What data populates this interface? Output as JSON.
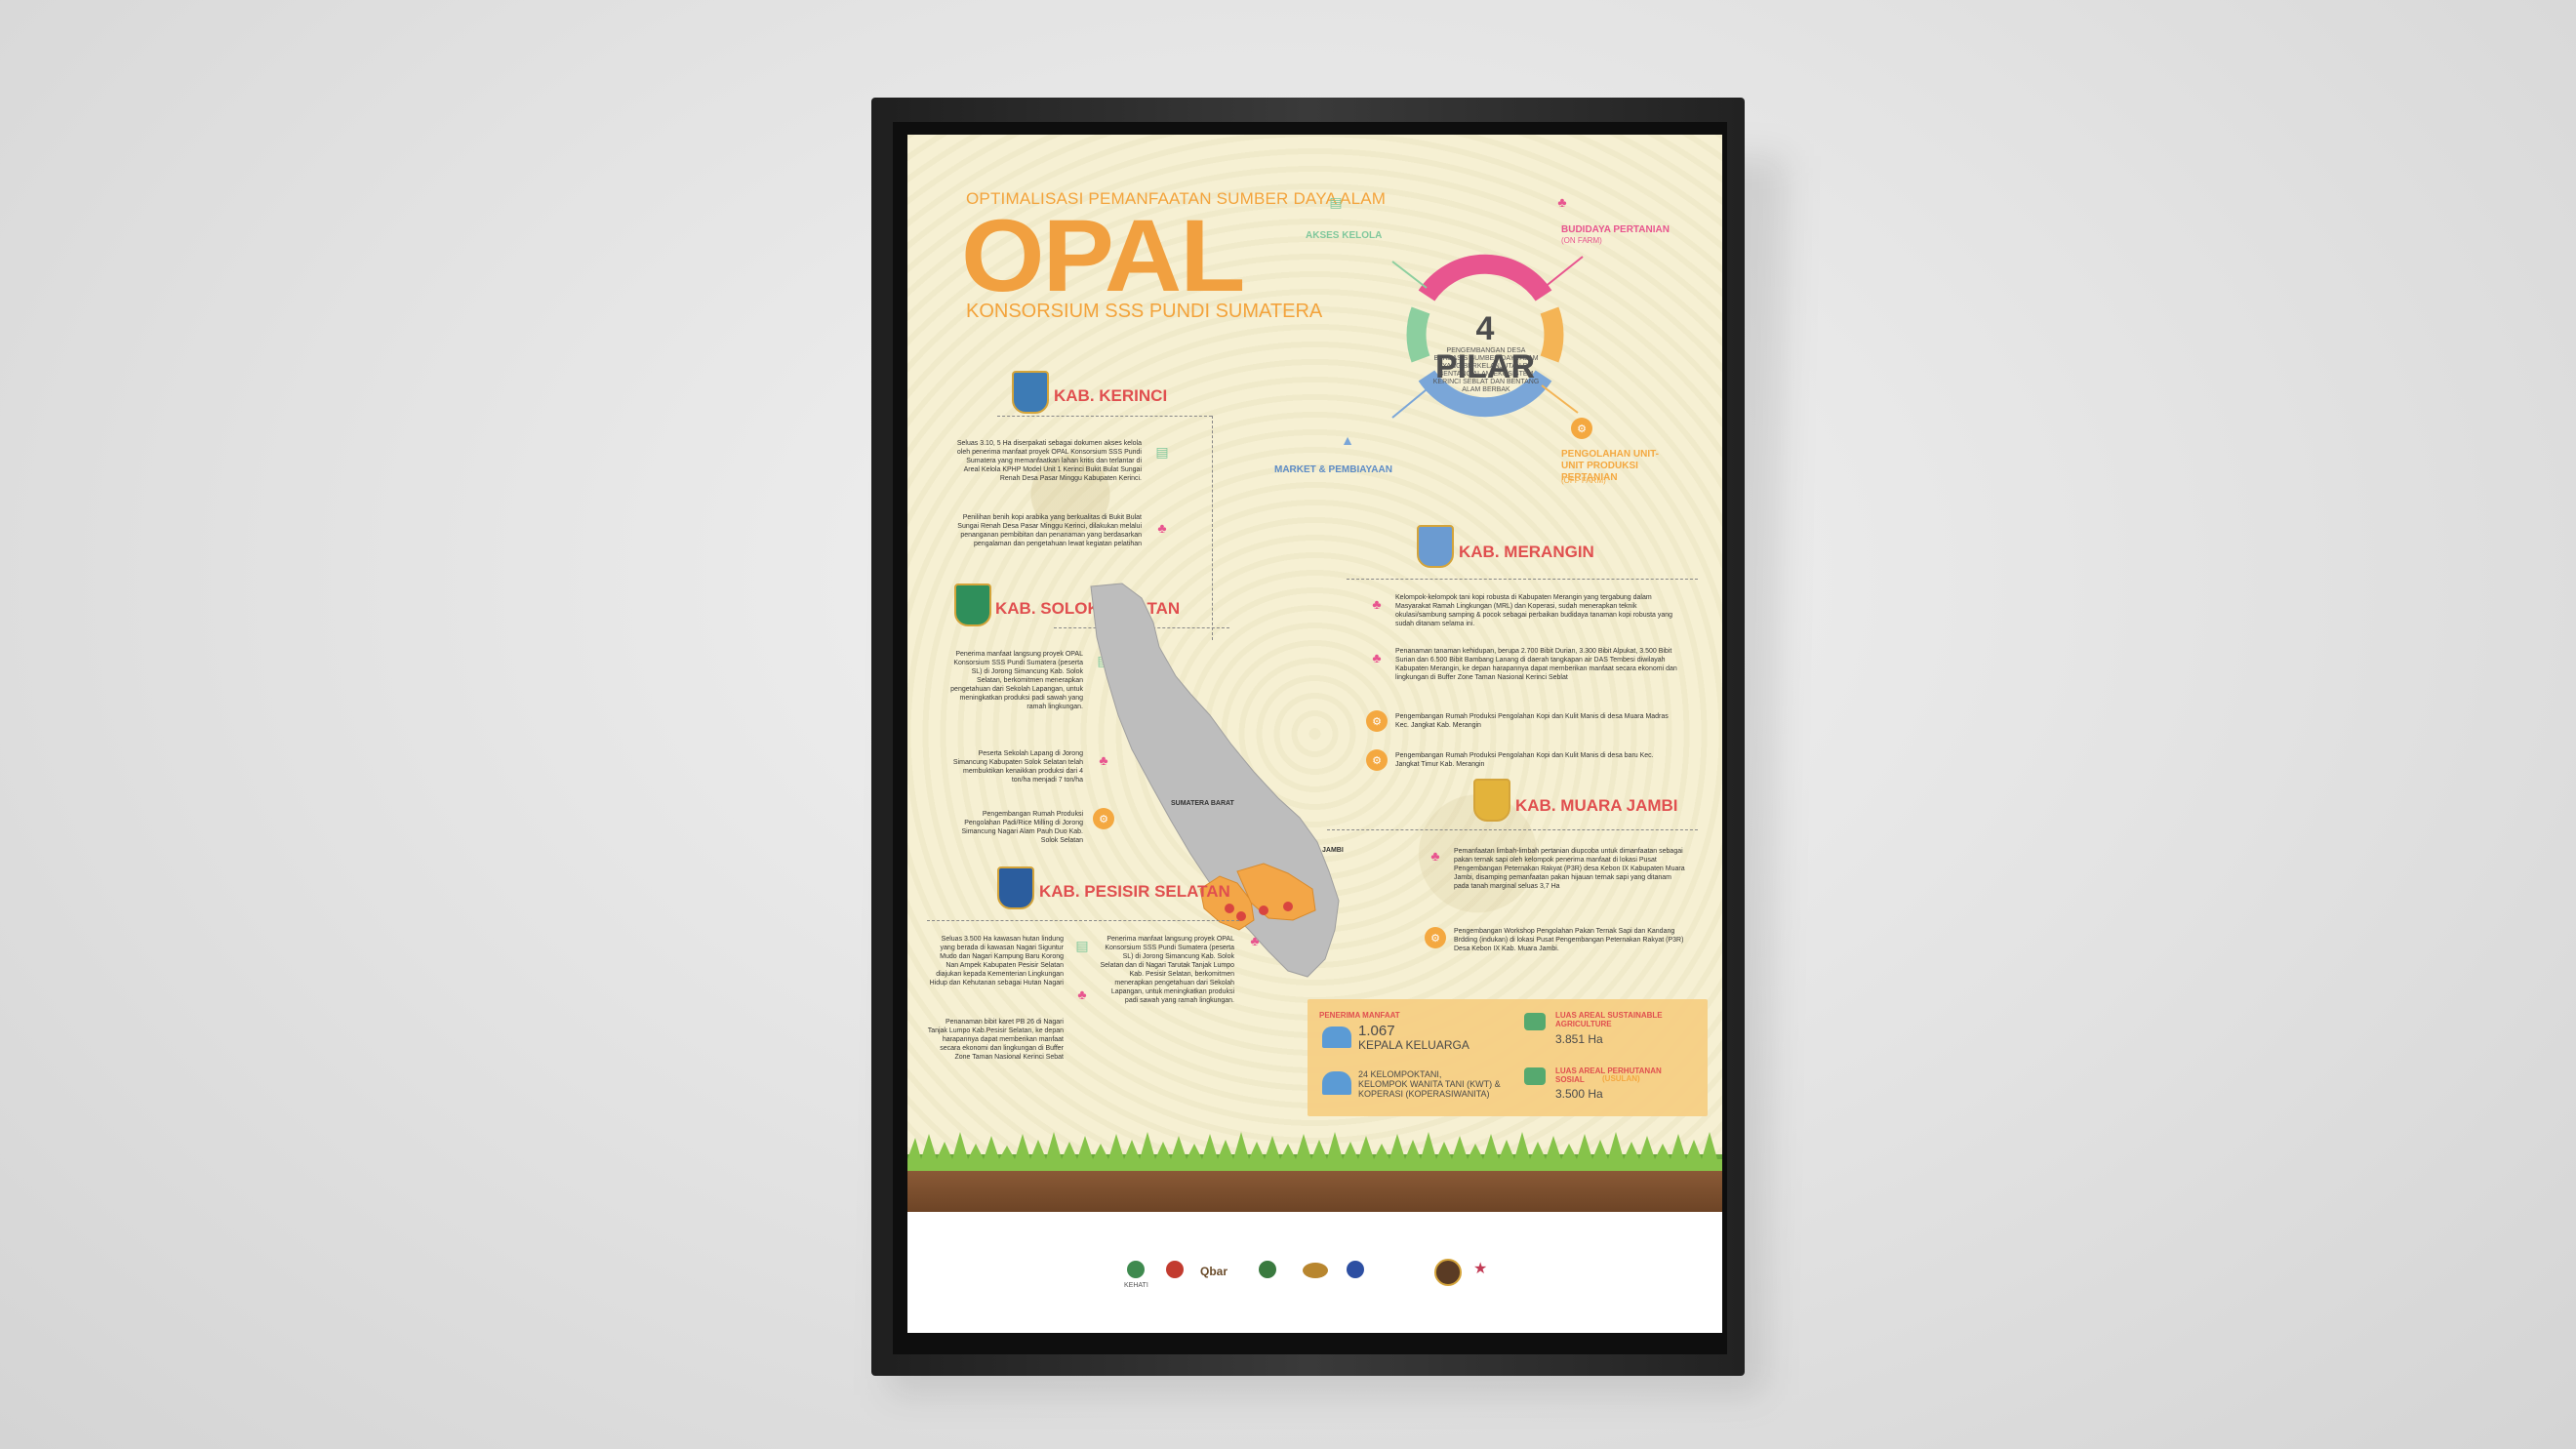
{
  "header": {
    "subtitle": "OPTIMALISASI PEMANFAATAN SUMBER DAYA ALAM",
    "title": "OPAL",
    "consortium": "KONSORSIUM SSS PUNDI SUMATERA"
  },
  "pilar": {
    "title": "4 PILAR",
    "description": "PENGEMBANGAN DESA BERBASIS SUMBER DAYA ALAM YANG BERKELANJUTAN DI BENTANG ALAM EKOSISTEM KERINCI SEBLAT DAN BENTANG ALAM BERBAK",
    "akses": "AKSES KELOLA",
    "budidaya": "BUDIDAYA PERTANIAN",
    "budidaya_sub": "(ON FARM)",
    "market": "MARKET & PEMBIAYAAN",
    "pengolahan": "PENGOLAHAN UNIT-UNIT PRODUKSI PERTANIAN",
    "pengolahan_sub": "(OFF FARM)",
    "colors": {
      "pink": "#e8558f",
      "orange": "#f4b455",
      "blue": "#7aa6d8",
      "green": "#8ccf9f"
    }
  },
  "kerinci": {
    "name": "KAB. KERINCI",
    "p1": "Seluas 3.10, 5 Ha diserpakati sebagai dokumen akses kelola oleh penerima manfaat proyek OPAL Konsorsium SSS Pundi Sumatera yang memanfaatkan lahan kritis dan terlantar di Areal Kelola KPHP Model Unit 1 Kerinci Bukit Bulat Sungai Renah Desa Pasar Minggu Kabupaten Kerinci.",
    "p2": "Penilihan benih kopi arabika yang berkualitas di Bukit Bulat Sungai Renah Desa Pasar Minggu Kerinci, dilakukan melalui penanganan pembibitan dan penanaman yang berdasarkan pengalaman dan pengetahuan lewat kegiatan pelatihan"
  },
  "solok": {
    "name": "KAB. SOLOK SELATAN",
    "p1": "Penerima manfaat langsung proyek OPAL Konsorsium SSS Pundi Sumatera (peserta SL) di Jorong Simancung Kab. Solok Selatan, berkomitmen menerapkan pengetahuan dari Sekolah Lapangan, untuk meningkatkan produksi padi sawah yang ramah lingkungan.",
    "p2": "Peserta Sekolah Lapang di Jorong Simancung Kabupaten Solok Selatan telah membuktikan kenaikkan produksi dari 4 ton/ha menjadi 7 ton/ha",
    "p3": "Pengembangan Rumah Produksi Pengolahan Padi/Rice Milling di Jorong Simancung Nagari Alam Pauh Duo Kab. Solok Selatan"
  },
  "pesisir": {
    "name": "KAB. PESISIR SELATAN",
    "p1": "Seluas 3.500 Ha kawasan hutan lindung yang berada di kawasan Nagari Siguntur Mudo dan Nagari Kampung Baru Korong Nan Ampek Kabupaten Pesisir Selatan diajukan kepada Kementerian Lingkungan Hidup dan Kehutanan sebagai Hutan Nagari",
    "p2": "Penanaman bibit karet PB 26 di Nagari Tanjak Lumpo Kab.Pesisir Selatan, ke depan harapannya dapat memberikan manfaat secara ekonomi dan lingkungan di Buffer Zone Taman Nasional Kerinci Sebat",
    "p3": "Penerima manfaat langsung proyek OPAL Konsorsium SSS Pundi Sumatera (peserta SL) di Jorong Simancung Kab. Solok Selatan dan di Nagari Tarutak Tanjak Lumpo Kab. Pesisir Selatan, berkomitmen menerapkan pengetahuan dari Sekolah Lapangan, untuk meningkatkan produksi padi sawah yang ramah lingkungan."
  },
  "merangin": {
    "name": "KAB. MERANGIN",
    "p1": "Kelompok-kelompok tani kopi robusta di Kabupaten Merangin yang tergabung dalam Masyarakat Ramah Lingkungan (MRL) dan Koperasi, sudah menerapkan teknik okulasi/sambung samping & pocok sebagai perbaikan budidaya tanaman kopi robusta yang sudah ditanam selama ini.",
    "p2": "Penanaman tanaman kehidupan, berupa 2.700 Bibit Durian, 3.300 Bibit Alpukat, 3.500 Bibit Surian dan 6.500 Bibit Bambang Lanang di daerah tangkapan air DAS Tembesi diwilayah Kabupaten Merangin, ke depan harapannya dapat memberikan manfaat secara ekonomi dan lingkungan di Buffer Zone Taman Nasional Kerinci Seblat",
    "p3": "Pengembangan Rumah Produksi Pengolahan Kopi dan Kulit Manis di desa Muara Madras Kec. Jangkat Kab. Merangin",
    "p4": "Pengembangan Rumah Produksi Pengolahan Kopi dan Kulit Manis di desa baru Kec. Jangkat Timur Kab. Merangin"
  },
  "muara_jambi": {
    "name": "KAB. MUARA JAMBI",
    "p1": "Pemanfaatan limbah-limbah pertanian diupcoba untuk dimanfaatan sebagai pakan ternak sapi oleh kelompok penerima manfaat di lokasi Pusat Pengembangan Peternakan Rakyat (P3R) desa Kebon IX Kabupaten Muara Jambi, disamping pemanfaatan pakan hijauan ternak sapi yang ditanam pada tanah marginal seluas 3,7 Ha",
    "p2": "Pengembangan Workshop Pengolahan Pakan Ternak Sapi dan Kandang Brdding (indukan) di lokasi Pusat Pengembangan Peternakan Rakyat (P3R) Desa Kebon IX Kab. Muara Jambi."
  },
  "map": {
    "label_sumbar": "SUMATERA BARAT",
    "label_jambi": "JAMBI"
  },
  "stats": {
    "penerima_title": "PENERIMA MANFAAT",
    "kk_value": "1.067",
    "kk_label": "KEPALA KELUARGA",
    "kwt_value": "24 KELOMPOKTANI,",
    "kwt_label": "KELOMPOK WANITA TANI (KWT) & KOPERASI (KOPERASIWANITA)",
    "areal1_title": "LUAS AREAL SUSTAINABLE AGRICULTURE",
    "areal1_value": "3.851 Ha",
    "areal2_title": "LUAS AREAL PERHUTANAN SOSIAL",
    "areal2_tag": "(USULAN)",
    "areal2_value": "3.500 Ha"
  },
  "footer": {
    "kehati": "KEHATI",
    "qbar": "Qbar"
  }
}
